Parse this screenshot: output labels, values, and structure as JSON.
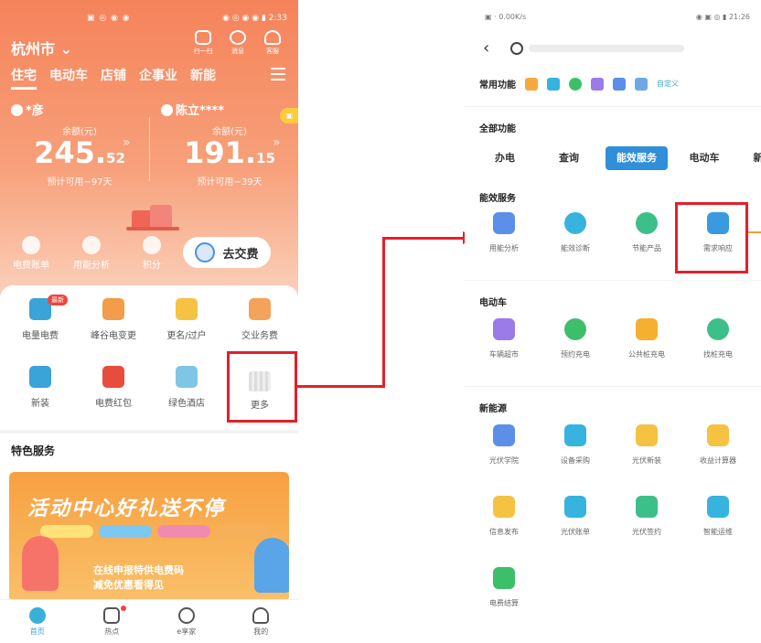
{
  "left": {
    "status_left": "▣ ◎ ◉ ◉",
    "status_right": "◉ ◎ ◉ ◉ ▮ 2:33",
    "city": "杭州市",
    "header_icons": [
      {
        "label": "扫一扫",
        "icon": "scan-icon"
      },
      {
        "label": "消息",
        "icon": "message-icon"
      },
      {
        "label": "客服",
        "icon": "headset-icon"
      }
    ],
    "tabs": [
      "住宅",
      "电动车",
      "店铺",
      "企事业",
      "新能"
    ],
    "accounts": [
      {
        "name": "*彦",
        "label": "余额(元)",
        "int": "245.",
        "dec": "52",
        "days": "预计可用−97天"
      },
      {
        "name": "陈立****",
        "label": "余额(元)",
        "int": "191.",
        "dec": "15",
        "days": "预计可用−39天"
      }
    ],
    "quick": [
      "电费账单",
      "用能分析",
      "积分"
    ],
    "pay_button": "去交费",
    "services": [
      {
        "label": "电量电费",
        "badge": "最新",
        "color": "#3aa3d8"
      },
      {
        "label": "峰谷电变更",
        "badge": "",
        "color": "#f39c4a"
      },
      {
        "label": "更名/过户",
        "badge": "",
        "color": "#f5c242"
      },
      {
        "label": "交业务费",
        "badge": "",
        "color": "#f3a35a"
      },
      {
        "label": "新装",
        "badge": "",
        "color": "#3aa3d8"
      },
      {
        "label": "电费红包",
        "badge": "",
        "color": "#e84c3d"
      },
      {
        "label": "绿色酒店",
        "badge": "",
        "color": "#7fc6e6"
      },
      {
        "label": "更多",
        "badge": "",
        "color": "#dddddd"
      }
    ],
    "feature_title": "特色服务",
    "banner_title": "活动中心好礼送不停",
    "banner_msg_1": "在线申报特供电费码",
    "banner_msg_2": "减免优惠看得见",
    "bottom_nav": [
      {
        "label": "首页",
        "active": true
      },
      {
        "label": "热点",
        "active": false
      },
      {
        "label": "e享家",
        "active": false
      },
      {
        "label": "我的",
        "active": false
      }
    ]
  },
  "right": {
    "status_left": "▣ · 0.00K/s",
    "status_right": "◉ ▣ ◎ ▮ 21:26",
    "common_label": "常用功能",
    "custom_label": "自定义",
    "all_label": "全部功能",
    "tabs": [
      "办电",
      "查询",
      "能效服务",
      "电动车",
      "新能源"
    ],
    "sections": [
      {
        "title": "能效服务",
        "items": [
          {
            "label": "用能分析",
            "color": "#5b8fe8"
          },
          {
            "label": "能效诊断",
            "color": "#37b3e0"
          },
          {
            "label": "节能产品",
            "color": "#3dbf8a"
          },
          {
            "label": "需求响应",
            "color": "#3a9ae0"
          }
        ]
      },
      {
        "title": "电动车",
        "items": [
          {
            "label": "车辆超市",
            "color": "#9b7be8"
          },
          {
            "label": "预约充电",
            "color": "#3dbf6a"
          },
          {
            "label": "公共桩充电",
            "color": "#f5b030"
          },
          {
            "label": "找桩充电",
            "color": "#3dbf8a"
          }
        ]
      },
      {
        "title": "新能源",
        "items": [
          {
            "label": "光伏学院",
            "color": "#5b8fe8"
          },
          {
            "label": "设备采购",
            "color": "#37b3e0"
          },
          {
            "label": "光伏新装",
            "color": "#f5c242"
          },
          {
            "label": "收益计算器",
            "color": "#f5c242"
          },
          {
            "label": "信息发布",
            "color": "#f5c242"
          },
          {
            "label": "光伏账单",
            "color": "#37b3e0"
          },
          {
            "label": "光伏签约",
            "color": "#3dbf8a"
          },
          {
            "label": "智能运维",
            "color": "#37b3e0"
          },
          {
            "label": "电费结算",
            "color": "#3dbf6a"
          }
        ]
      }
    ]
  },
  "colors": {
    "highlight": "#e4202a",
    "accent": "#2f8fd8",
    "hero": "#f5835a"
  }
}
